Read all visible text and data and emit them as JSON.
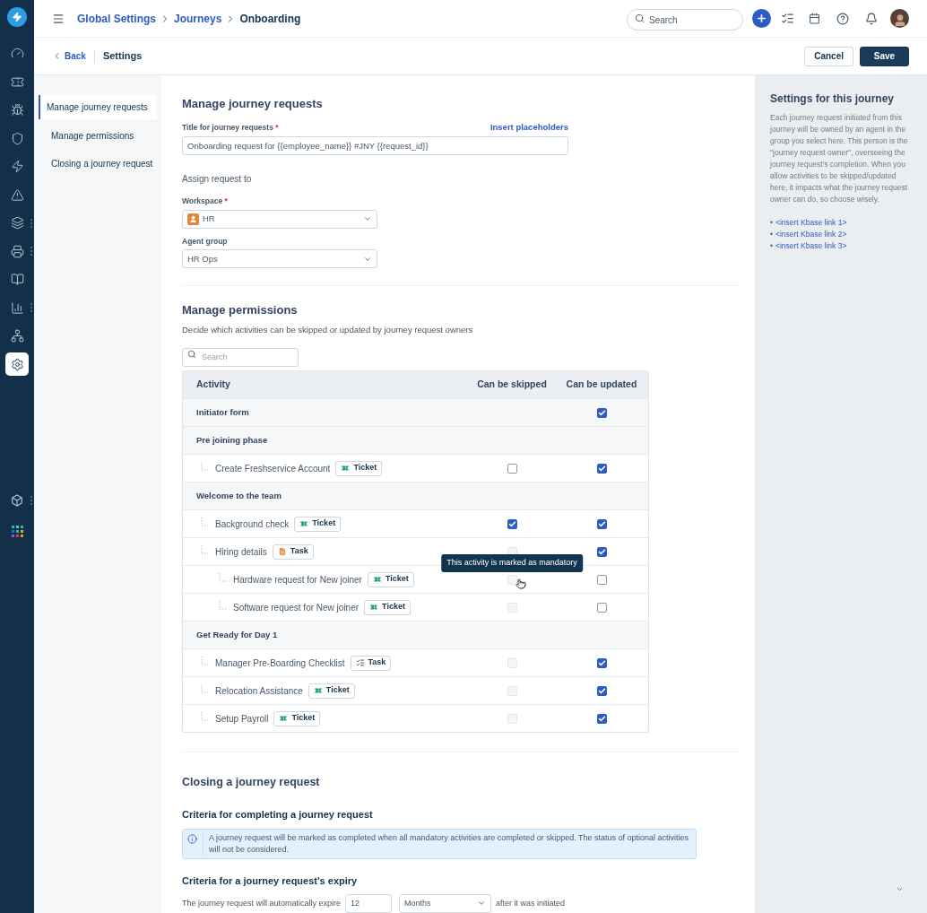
{
  "rail": {
    "items": [
      {
        "selected": false,
        "has_menu": false
      },
      {
        "selected": false,
        "has_menu": false
      },
      {
        "selected": false,
        "has_menu": false
      },
      {
        "selected": false,
        "has_menu": false
      },
      {
        "selected": false,
        "has_menu": false
      },
      {
        "selected": false,
        "has_menu": false
      },
      {
        "selected": false,
        "has_menu": true
      },
      {
        "selected": false,
        "has_menu": true
      },
      {
        "selected": false,
        "has_menu": false
      },
      {
        "selected": false,
        "has_menu": true
      },
      {
        "selected": false,
        "has_menu": false
      },
      {
        "selected": true,
        "has_menu": false
      }
    ],
    "bottom_items": [
      {
        "kind": "box",
        "has_menu": true
      },
      {
        "kind": "apps",
        "has_menu": false
      }
    ]
  },
  "breadcrumb": [
    {
      "label": "Global Settings",
      "link": true
    },
    {
      "label": "Journeys",
      "link": true
    },
    {
      "label": "Onboarding",
      "link": false
    }
  ],
  "search": {
    "placeholder": "Search"
  },
  "subheader": {
    "back": "Back",
    "title": "Settings",
    "buttons": [
      {
        "label": "Cancel",
        "primary": false
      },
      {
        "label": "Save",
        "primary": true
      }
    ]
  },
  "nav": [
    {
      "label": "Manage journey requests",
      "selected": true
    },
    {
      "label": "Manage permissions",
      "selected": false
    },
    {
      "label": "Closing a journey request",
      "selected": false
    }
  ],
  "requests": {
    "heading": "Manage journey requests",
    "title_label": "Title for journey requests",
    "title_required_mark": "*",
    "insert_link": "Insert placeholders",
    "title_value": "Onboarding request for {{employee_name}} #JNY {{request_id}}",
    "assign_heading": "Assign request to",
    "workspace": {
      "label": "Workspace",
      "required_mark": "*",
      "value": "HR"
    },
    "agent_group": {
      "label": "Agent group",
      "value": "HR Ops"
    }
  },
  "permissions": {
    "heading": "Manage permissions",
    "description": "Decide which activities can be skipped or updated by journey request owners",
    "search_placeholder": "Search",
    "columns": [
      "Activity",
      "Can be skipped",
      "Can be updated"
    ],
    "rows": [
      {
        "label": "Initiator form",
        "updated": true
      },
      {
        "label": "Pre joining phase",
        "children": [
          {
            "label": "Create Freshservice Account",
            "tag": {
              "label": "Ticket",
              "kind": "ticket"
            },
            "skipped": {
              "checked": false,
              "disabled": false
            },
            "updated": true
          }
        ]
      },
      {
        "label": "Welcome to the team",
        "children": [
          {
            "label": "Background check",
            "tag": {
              "label": "Ticket",
              "kind": "ticket"
            },
            "skipped": {
              "checked": true,
              "disabled": false
            },
            "updated": true
          },
          {
            "label": "Hiring details",
            "tag": {
              "label": "Task",
              "kind": "task"
            },
            "skipped": {
              "checked": false,
              "disabled": true
            },
            "updated": true,
            "children": [
              {
                "label": "Hardware request for New joiner",
                "tag": {
                  "label": "Ticket",
                  "kind": "ticket"
                },
                "skipped": {
                  "checked": false,
                  "disabled": true
                },
                "updated": false,
                "tooltip": "This activity is marked as mandatory"
              },
              {
                "label": "Software request for New joiner",
                "tag": {
                  "label": "Ticket",
                  "kind": "ticket"
                },
                "skipped": {
                  "checked": false,
                  "disabled": true
                },
                "updated": false
              }
            ]
          }
        ]
      },
      {
        "label": "Get Ready for Day 1",
        "children": [
          {
            "label": "Manager Pre-Boarding Checklist",
            "tag": {
              "label": "Task",
              "kind": "checklist"
            },
            "skipped": {
              "checked": false,
              "disabled": true
            },
            "updated": true
          },
          {
            "label": "Relocation Assistance",
            "tag": {
              "label": "Ticket",
              "kind": "ticket"
            },
            "skipped": {
              "checked": false,
              "disabled": true
            },
            "updated": true
          },
          {
            "label": "Setup Payroll",
            "tag": {
              "label": "Ticket",
              "kind": "ticket"
            },
            "skipped": {
              "checked": false,
              "disabled": true
            },
            "updated": true
          }
        ]
      }
    ]
  },
  "closing": {
    "heading": "Closing a journey request",
    "completion_heading": "Criteria for completing a journey request",
    "info": "A journey request will be marked as completed when all mandatory activities are completed or skipped. The status of optional activities will not be considered.",
    "expiry_heading": "Criteria for a journey request's expiry",
    "expiry_before": "The journey request will automatically expire",
    "expiry_value": "12",
    "expiry_unit": "Months",
    "expiry_after": "after it was initiated"
  },
  "side_panel": {
    "title": "Settings for this journey",
    "text": "Each journey request initiated from this journey will be owned by an agent in the group you select here. This person is the \"journey request owner\", overseeing the journey request's completion. When you allow activities to be skipped/updated here, it impacts what the journey request owner can do, so choose wisely.",
    "links": [
      {
        "bullet": "•",
        "label": "<insert Kbase link 1>"
      },
      {
        "bullet": "•",
        "label": "<insert Kbase link 2>"
      },
      {
        "bullet": "•",
        "label": "<insert Kbase link 3>"
      }
    ]
  }
}
